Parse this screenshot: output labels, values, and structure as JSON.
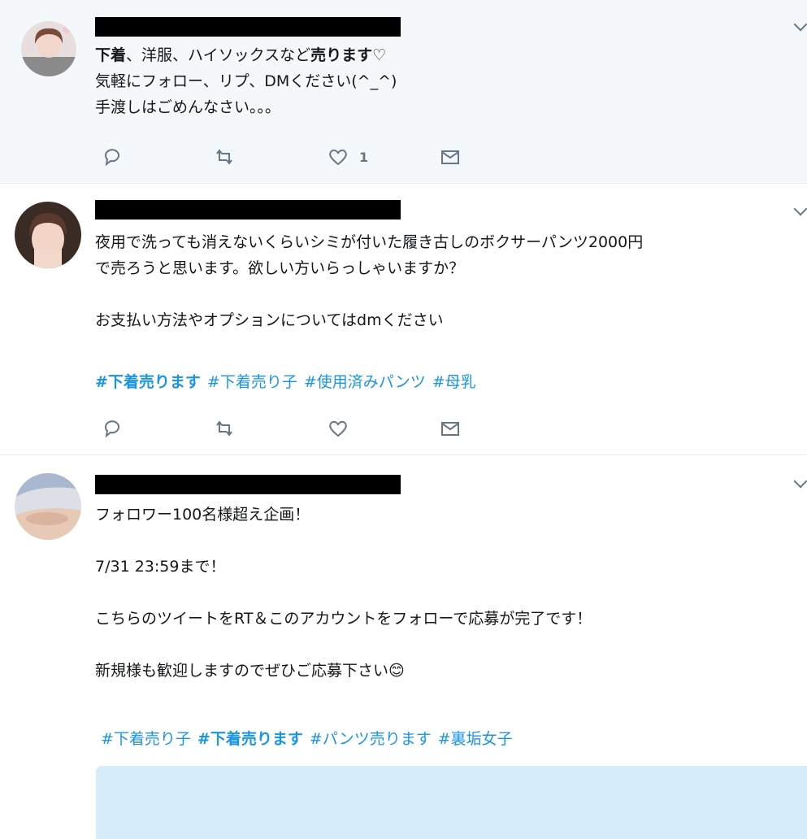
{
  "tweets": [
    {
      "lines": [
        {
          "parts": [
            {
              "text": "下着",
              "bold": true
            },
            {
              "text": "、洋服、ハイソックスなど",
              "bold": false
            },
            {
              "text": "売ります",
              "bold": true
            },
            {
              "text": "♡",
              "bold": false
            }
          ]
        },
        {
          "parts": [
            {
              "text": "気軽にフォロー、リプ、DMください(^_^)",
              "bold": false
            }
          ]
        },
        {
          "parts": [
            {
              "text": "手渡しはごめんなさい。。。",
              "bold": false
            }
          ]
        }
      ],
      "like_count": "1"
    },
    {
      "lines": [
        {
          "parts": [
            {
              "text": "夜用で洗っても消えないくらいシミが付いた履き古しのボクサーパンツ2000円",
              "bold": false
            }
          ]
        },
        {
          "parts": [
            {
              "text": "で売ろうと思います。欲しい方いらっしゃいますか？",
              "bold": false
            }
          ]
        },
        {
          "parts": []
        },
        {
          "parts": [
            {
              "text": "お支払い方法やオプションについてはdmください",
              "bold": false
            }
          ]
        }
      ],
      "hashtags": [
        "#下着売ります",
        "#下着売り子",
        "#使用済みパンツ",
        "#母乳"
      ]
    },
    {
      "lines": [
        {
          "parts": [
            {
              "text": "フォロワー100名様超え企画！",
              "bold": false
            }
          ]
        },
        {
          "parts": []
        },
        {
          "parts": [
            {
              "text": "7/31 23:59まで！",
              "bold": false
            }
          ]
        },
        {
          "parts": []
        },
        {
          "parts": [
            {
              "text": "こちらのツイートをRT＆このアカウントをフォローで応募が完了です！",
              "bold": false
            }
          ]
        },
        {
          "parts": []
        },
        {
          "parts": [
            {
              "text": "新規様も歓迎しますのでぜひご応募下さい😊",
              "bold": false
            }
          ]
        }
      ],
      "hashtags": [
        "#下着売り子",
        "#下着売ります",
        "#パンツ売ります",
        "#裏垢女子"
      ]
    }
  ],
  "icons": {
    "reply": "reply-icon",
    "retweet": "retweet-icon",
    "like": "heart-icon",
    "dm": "envelope-icon",
    "menu": "chevron-down-icon"
  },
  "colors": {
    "hashtag": "#1b95e0",
    "action_icon": "#657786",
    "highlight_bg": "#f5f8fa"
  }
}
